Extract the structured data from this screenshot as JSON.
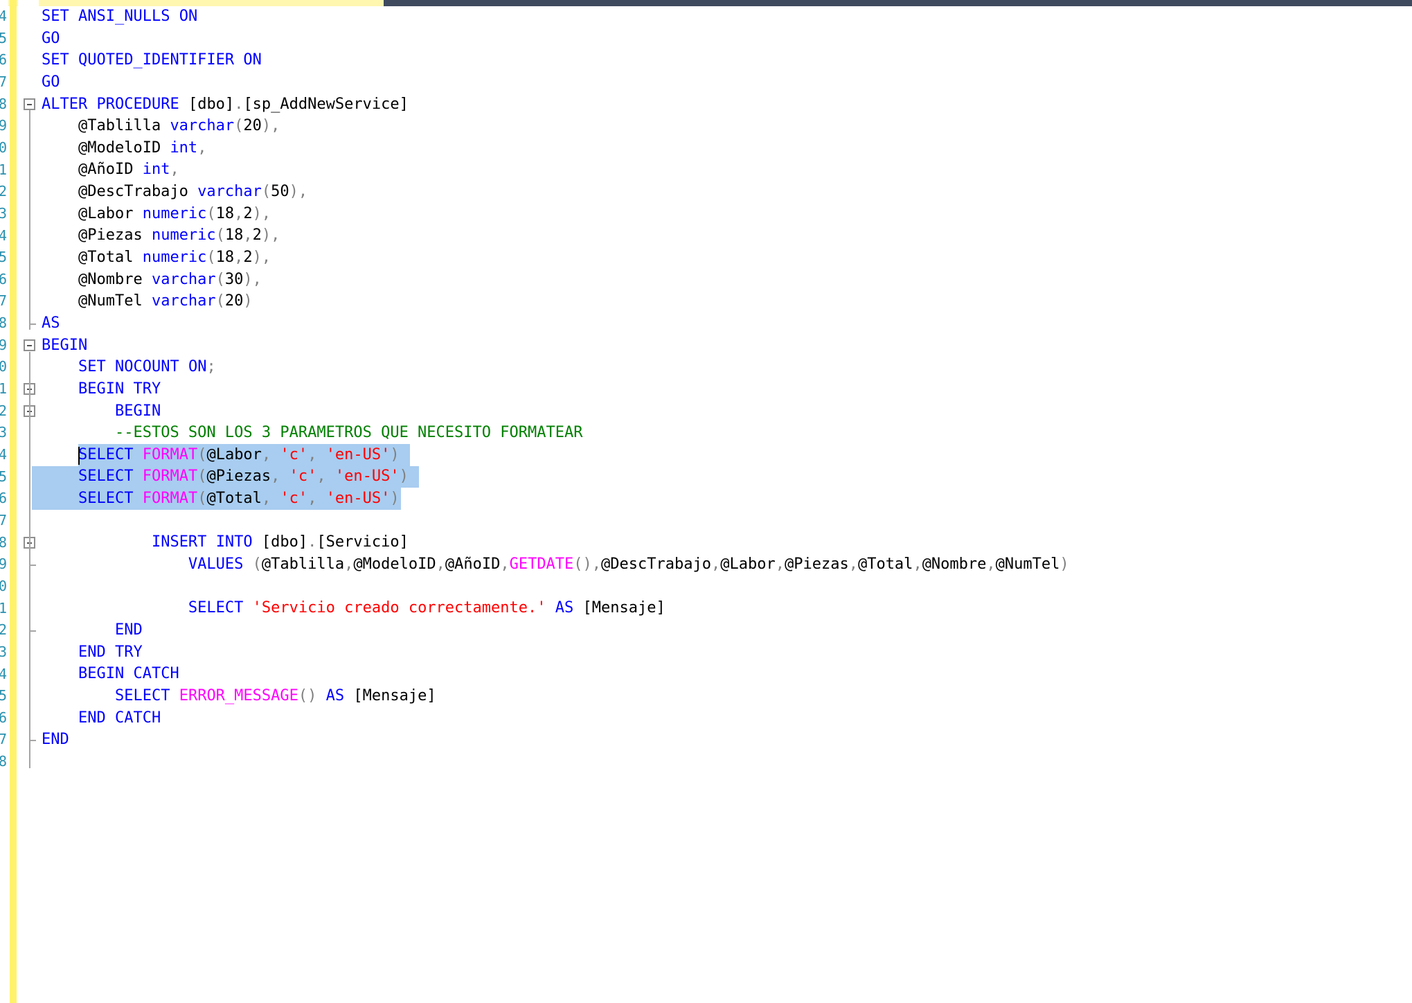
{
  "editor": {
    "line_numbers": [
      "4",
      "5",
      "6",
      "7",
      "8",
      "9",
      "0",
      "1",
      "2",
      "3",
      "4",
      "5",
      "6",
      "7",
      "8",
      "9",
      "0",
      "1",
      "2",
      "3",
      "4",
      "5",
      "6",
      "7",
      "8",
      "9",
      "0",
      "1",
      "2",
      "3",
      "4",
      "5",
      "6",
      "7",
      "8"
    ],
    "lines": [
      [
        {
          "t": "SET",
          "c": "kw"
        },
        {
          "t": " ",
          "c": "id"
        },
        {
          "t": "ANSI_NULLS",
          "c": "kw"
        },
        {
          "t": " ",
          "c": "id"
        },
        {
          "t": "ON",
          "c": "kw"
        }
      ],
      [
        {
          "t": "GO",
          "c": "kw"
        }
      ],
      [
        {
          "t": "SET",
          "c": "kw"
        },
        {
          "t": " ",
          "c": "id"
        },
        {
          "t": "QUOTED_IDENTIFIER",
          "c": "kw"
        },
        {
          "t": " ",
          "c": "id"
        },
        {
          "t": "ON",
          "c": "kw"
        }
      ],
      [
        {
          "t": "GO",
          "c": "kw"
        }
      ],
      [
        {
          "t": "ALTER",
          "c": "kw"
        },
        {
          "t": " ",
          "c": "id"
        },
        {
          "t": "PROCEDURE",
          "c": "kw"
        },
        {
          "t": " [dbo]",
          "c": "id"
        },
        {
          "t": ".",
          "c": "op"
        },
        {
          "t": "[sp_AddNewService]",
          "c": "id"
        }
      ],
      [
        {
          "t": "    @Tablilla ",
          "c": "id"
        },
        {
          "t": "varchar",
          "c": "kw"
        },
        {
          "t": "(",
          "c": "op"
        },
        {
          "t": "20",
          "c": "id"
        },
        {
          "t": "),",
          "c": "op"
        }
      ],
      [
        {
          "t": "    @ModeloID ",
          "c": "id"
        },
        {
          "t": "int",
          "c": "kw"
        },
        {
          "t": ",",
          "c": "op"
        }
      ],
      [
        {
          "t": "    @AñoID ",
          "c": "id"
        },
        {
          "t": "int",
          "c": "kw"
        },
        {
          "t": ",",
          "c": "op"
        }
      ],
      [
        {
          "t": "    @DescTrabajo ",
          "c": "id"
        },
        {
          "t": "varchar",
          "c": "kw"
        },
        {
          "t": "(",
          "c": "op"
        },
        {
          "t": "50",
          "c": "id"
        },
        {
          "t": "),",
          "c": "op"
        }
      ],
      [
        {
          "t": "    @Labor ",
          "c": "id"
        },
        {
          "t": "numeric",
          "c": "kw"
        },
        {
          "t": "(",
          "c": "op"
        },
        {
          "t": "18",
          "c": "id"
        },
        {
          "t": ",",
          "c": "op"
        },
        {
          "t": "2",
          "c": "id"
        },
        {
          "t": "),",
          "c": "op"
        }
      ],
      [
        {
          "t": "    @Piezas ",
          "c": "id"
        },
        {
          "t": "numeric",
          "c": "kw"
        },
        {
          "t": "(",
          "c": "op"
        },
        {
          "t": "18",
          "c": "id"
        },
        {
          "t": ",",
          "c": "op"
        },
        {
          "t": "2",
          "c": "id"
        },
        {
          "t": "),",
          "c": "op"
        }
      ],
      [
        {
          "t": "    @Total ",
          "c": "id"
        },
        {
          "t": "numeric",
          "c": "kw"
        },
        {
          "t": "(",
          "c": "op"
        },
        {
          "t": "18",
          "c": "id"
        },
        {
          "t": ",",
          "c": "op"
        },
        {
          "t": "2",
          "c": "id"
        },
        {
          "t": "),",
          "c": "op"
        }
      ],
      [
        {
          "t": "    @Nombre ",
          "c": "id"
        },
        {
          "t": "varchar",
          "c": "kw"
        },
        {
          "t": "(",
          "c": "op"
        },
        {
          "t": "30",
          "c": "id"
        },
        {
          "t": "),",
          "c": "op"
        }
      ],
      [
        {
          "t": "    @NumTel ",
          "c": "id"
        },
        {
          "t": "varchar",
          "c": "kw"
        },
        {
          "t": "(",
          "c": "op"
        },
        {
          "t": "20",
          "c": "id"
        },
        {
          "t": ")",
          "c": "op"
        }
      ],
      [
        {
          "t": "AS",
          "c": "kw"
        }
      ],
      [
        {
          "t": "BEGIN",
          "c": "kw"
        }
      ],
      [
        {
          "t": "    ",
          "c": "id"
        },
        {
          "t": "SET",
          "c": "kw"
        },
        {
          "t": " ",
          "c": "id"
        },
        {
          "t": "NOCOUNT",
          "c": "kw"
        },
        {
          "t": " ",
          "c": "id"
        },
        {
          "t": "ON",
          "c": "kw"
        },
        {
          "t": ";",
          "c": "op"
        }
      ],
      [
        {
          "t": "    ",
          "c": "id"
        },
        {
          "t": "BEGIN",
          "c": "kw"
        },
        {
          "t": " ",
          "c": "id"
        },
        {
          "t": "TRY",
          "c": "kw"
        }
      ],
      [
        {
          "t": "        ",
          "c": "id"
        },
        {
          "t": "BEGIN",
          "c": "kw"
        }
      ],
      [
        {
          "t": "        ",
          "c": "id"
        },
        {
          "t": "--ESTOS SON LOS 3 PARAMETROS QUE NECESITO FORMATEAR",
          "c": "cmt"
        }
      ],
      [
        {
          "t": "    ",
          "c": "id"
        },
        {
          "t": "SELECT",
          "c": "kw"
        },
        {
          "t": " ",
          "c": "id"
        },
        {
          "t": "FORMAT",
          "c": "fn"
        },
        {
          "t": "(",
          "c": "op"
        },
        {
          "t": "@Labor",
          "c": "id"
        },
        {
          "t": ", ",
          "c": "op"
        },
        {
          "t": "'c'",
          "c": "str"
        },
        {
          "t": ", ",
          "c": "op"
        },
        {
          "t": "'en-US'",
          "c": "str"
        },
        {
          "t": ")",
          "c": "op"
        }
      ],
      [
        {
          "t": "    ",
          "c": "id"
        },
        {
          "t": "SELECT",
          "c": "kw"
        },
        {
          "t": " ",
          "c": "id"
        },
        {
          "t": "FORMAT",
          "c": "fn"
        },
        {
          "t": "(",
          "c": "op"
        },
        {
          "t": "@Piezas",
          "c": "id"
        },
        {
          "t": ", ",
          "c": "op"
        },
        {
          "t": "'c'",
          "c": "str"
        },
        {
          "t": ", ",
          "c": "op"
        },
        {
          "t": "'en-US'",
          "c": "str"
        },
        {
          "t": ")",
          "c": "op"
        }
      ],
      [
        {
          "t": "    ",
          "c": "id"
        },
        {
          "t": "SELECT",
          "c": "kw"
        },
        {
          "t": " ",
          "c": "id"
        },
        {
          "t": "FORMAT",
          "c": "fn"
        },
        {
          "t": "(",
          "c": "op"
        },
        {
          "t": "@Total",
          "c": "id"
        },
        {
          "t": ", ",
          "c": "op"
        },
        {
          "t": "'c'",
          "c": "str"
        },
        {
          "t": ", ",
          "c": "op"
        },
        {
          "t": "'en-US'",
          "c": "str"
        },
        {
          "t": ")",
          "c": "op"
        }
      ],
      [],
      [
        {
          "t": "            ",
          "c": "id"
        },
        {
          "t": "INSERT",
          "c": "kw"
        },
        {
          "t": " ",
          "c": "id"
        },
        {
          "t": "INTO",
          "c": "kw"
        },
        {
          "t": " [dbo]",
          "c": "id"
        },
        {
          "t": ".",
          "c": "op"
        },
        {
          "t": "[Servicio]",
          "c": "id"
        }
      ],
      [
        {
          "t": "                ",
          "c": "id"
        },
        {
          "t": "VALUES",
          "c": "kw"
        },
        {
          "t": " (",
          "c": "op"
        },
        {
          "t": "@Tablilla",
          "c": "id"
        },
        {
          "t": ",",
          "c": "op"
        },
        {
          "t": "@ModeloID",
          "c": "id"
        },
        {
          "t": ",",
          "c": "op"
        },
        {
          "t": "@AñoID",
          "c": "id"
        },
        {
          "t": ",",
          "c": "op"
        },
        {
          "t": "GETDATE",
          "c": "fn"
        },
        {
          "t": "(),",
          "c": "op"
        },
        {
          "t": "@DescTrabajo",
          "c": "id"
        },
        {
          "t": ",",
          "c": "op"
        },
        {
          "t": "@Labor",
          "c": "id"
        },
        {
          "t": ",",
          "c": "op"
        },
        {
          "t": "@Piezas",
          "c": "id"
        },
        {
          "t": ",",
          "c": "op"
        },
        {
          "t": "@Total",
          "c": "id"
        },
        {
          "t": ",",
          "c": "op"
        },
        {
          "t": "@Nombre",
          "c": "id"
        },
        {
          "t": ",",
          "c": "op"
        },
        {
          "t": "@NumTel",
          "c": "id"
        },
        {
          "t": ")",
          "c": "op"
        }
      ],
      [],
      [
        {
          "t": "                ",
          "c": "id"
        },
        {
          "t": "SELECT",
          "c": "kw"
        },
        {
          "t": " ",
          "c": "id"
        },
        {
          "t": "'Servicio creado correctamente.'",
          "c": "str"
        },
        {
          "t": " ",
          "c": "id"
        },
        {
          "t": "AS",
          "c": "kw"
        },
        {
          "t": " [Mensaje]",
          "c": "id"
        }
      ],
      [
        {
          "t": "        ",
          "c": "id"
        },
        {
          "t": "END",
          "c": "kw"
        }
      ],
      [
        {
          "t": "    ",
          "c": "id"
        },
        {
          "t": "END",
          "c": "kw"
        },
        {
          "t": " ",
          "c": "id"
        },
        {
          "t": "TRY",
          "c": "kw"
        }
      ],
      [
        {
          "t": "    ",
          "c": "id"
        },
        {
          "t": "BEGIN",
          "c": "kw"
        },
        {
          "t": " ",
          "c": "id"
        },
        {
          "t": "CATCH",
          "c": "kw"
        }
      ],
      [
        {
          "t": "        ",
          "c": "id"
        },
        {
          "t": "SELECT",
          "c": "kw"
        },
        {
          "t": " ",
          "c": "id"
        },
        {
          "t": "ERROR_MESSAGE",
          "c": "fn"
        },
        {
          "t": "()",
          "c": "op"
        },
        {
          "t": " ",
          "c": "id"
        },
        {
          "t": "AS",
          "c": "kw"
        },
        {
          "t": " [Mensaje]",
          "c": "id"
        }
      ],
      [
        {
          "t": "    ",
          "c": "id"
        },
        {
          "t": "END",
          "c": "kw"
        },
        {
          "t": " ",
          "c": "id"
        },
        {
          "t": "CATCH",
          "c": "kw"
        }
      ],
      [
        {
          "t": "END",
          "c": "kw"
        }
      ],
      []
    ],
    "colors": {
      "keyword": "#0000ff",
      "function": "#ff00ff",
      "string": "#ff0000",
      "comment": "#008000",
      "operator": "#808080",
      "line_number": "#2b91af",
      "selection": "#a8cdf0",
      "change_margin": "#fff26b"
    }
  }
}
